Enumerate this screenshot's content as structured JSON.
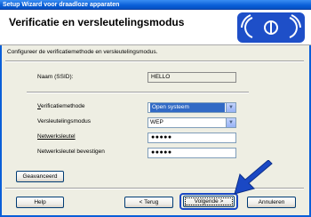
{
  "window": {
    "title": "Setup Wizard voor draadloze apparaten"
  },
  "header": {
    "title": "Verificatie en versleutelingsmodus"
  },
  "instruction": "Configureer de verificatiemethode en versleutelingsmodus.",
  "ssid": {
    "label": "Naam (SSID):",
    "value": "HELLO"
  },
  "auth": {
    "label": "Verificatiemethode",
    "value": "Open systeem"
  },
  "enc": {
    "label": "Versleutelingsmodus",
    "value": "WEP"
  },
  "netkey": {
    "label": "Netwerksleutel",
    "value": "●●●●●"
  },
  "netkey_confirm": {
    "label": "Netwerksleutel bevestigen",
    "value": "●●●●●"
  },
  "buttons": {
    "advanced": "Geavanceerd",
    "help": "Help",
    "back": "< Terug",
    "next": "Volgende >",
    "cancel": "Annuleren"
  },
  "colors": {
    "titlebar": "#0a5fd8",
    "frame": "#eeeee3",
    "accent": "#1a48c4"
  }
}
